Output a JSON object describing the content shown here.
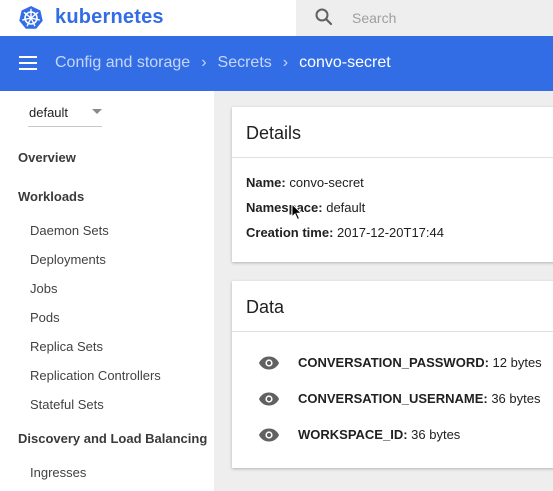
{
  "app": {
    "brand": "kubernetes"
  },
  "search": {
    "placeholder": "Search"
  },
  "breadcrumb": {
    "items": [
      "Config and storage",
      "Secrets"
    ],
    "current": "convo-secret"
  },
  "sidebar": {
    "namespace": "default",
    "overview": "Overview",
    "workloads": "Workloads",
    "workload_items": [
      "Daemon Sets",
      "Deployments",
      "Jobs",
      "Pods",
      "Replica Sets",
      "Replication Controllers",
      "Stateful Sets"
    ],
    "discovery": "Discovery and Load Balancing",
    "discovery_items": [
      "Ingresses"
    ]
  },
  "details": {
    "title": "Details",
    "rows": [
      {
        "label": "Name:",
        "value": " convo-secret"
      },
      {
        "label": "Namespace:",
        "value": " default"
      },
      {
        "label": "Creation time:",
        "value": " 2017-12-20T17:44"
      }
    ]
  },
  "data_card": {
    "title": "Data",
    "entries": [
      {
        "key": "CONVERSATION_PASSWORD:",
        "value": " 12 bytes"
      },
      {
        "key": "CONVERSATION_USERNAME:",
        "value": " 36 bytes"
      },
      {
        "key": "WORKSPACE_ID:",
        "value": " 36 bytes"
      }
    ]
  },
  "colors": {
    "accent": "#326de6",
    "background": "#eeeeee",
    "icon": "#616161"
  }
}
